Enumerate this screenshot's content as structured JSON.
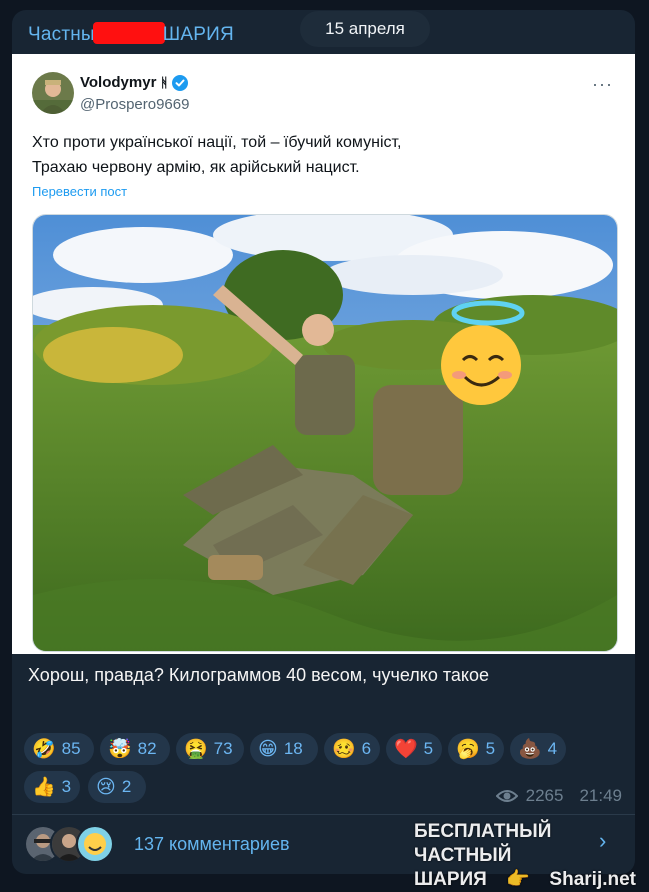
{
  "channel": {
    "name_left": "Частны",
    "name_right": "ШАРИЯ"
  },
  "date_pill": "15 апреля",
  "tweet": {
    "author_name": "Volodymyr",
    "author_glyph": "ᚻ",
    "handle": "@Prospero9669",
    "text_lines": [
      "Хто проти української нації, той – їбучий комуніст,",
      "Трахаю червону армію, як арійський нацист."
    ],
    "translate_link": "Перевести пост",
    "more": "···"
  },
  "caption": "Хорош, правда? Килограммов 40 весом, чучелко такое",
  "reactions": [
    {
      "emoji": "🤣",
      "count": "85"
    },
    {
      "emoji": "🤯",
      "count": "82"
    },
    {
      "emoji": "🤮",
      "count": "73"
    },
    {
      "emoji": "😁",
      "count": "18"
    },
    {
      "emoji": "🥴",
      "count": "6"
    },
    {
      "emoji": "❤️",
      "count": "5"
    },
    {
      "emoji": "🥱",
      "count": "5"
    },
    {
      "emoji": "💩",
      "count": "4"
    },
    {
      "emoji": "👍",
      "count": "3"
    },
    {
      "emoji": "😢",
      "count": "2"
    }
  ],
  "meta": {
    "views": "2265",
    "time": "21:49"
  },
  "comments": {
    "label": "137 комментариев"
  },
  "watermark": {
    "line1": "БЕСПЛАТНЫЙ ЧАСТНЫЙ",
    "line2_left": "ШАРИЯ",
    "line2_right": "Sharij.net"
  },
  "colors": {
    "background": "#0e1621",
    "bubble": "#182533",
    "accent": "#64b5ef",
    "reaction_bg": "#23364a",
    "verified": "#1d9bf0"
  }
}
